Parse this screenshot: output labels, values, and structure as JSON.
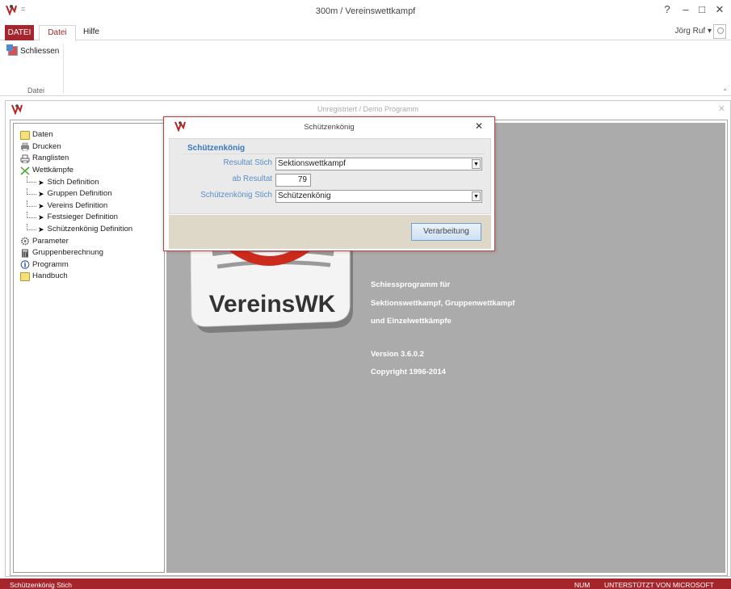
{
  "window": {
    "title": "300m / Vereinswettkampf"
  },
  "title_controls": {
    "help": "?",
    "minimize": "–",
    "maximize": "□",
    "close": "✕"
  },
  "ribbon": {
    "file_tab": "DATEI",
    "tabs": [
      "Datei",
      "Hilfe"
    ],
    "active_tab": "Datei",
    "user": "Jörg Ruf ▾",
    "close_button": "Schliessen",
    "group_label": "Datei"
  },
  "main_window": {
    "title": "Unregistriert  /  Demo Programm"
  },
  "tree": {
    "items": [
      {
        "label": "Daten",
        "icon": "folder-icon",
        "level": 0
      },
      {
        "label": "Drucken",
        "icon": "printer-icon",
        "level": 0
      },
      {
        "label": "Ranglisten",
        "icon": "print-list-icon",
        "level": 0
      },
      {
        "label": "Wettkämpfe",
        "icon": "competition-icon",
        "level": 0
      },
      {
        "label": "Stich Definition",
        "icon": "arrow-icon",
        "level": 1
      },
      {
        "label": "Gruppen Definition",
        "icon": "arrow-icon",
        "level": 1
      },
      {
        "label": "Vereins Definition",
        "icon": "arrow-icon",
        "level": 1
      },
      {
        "label": "Festsieger Definition",
        "icon": "arrow-icon",
        "level": 1
      },
      {
        "label": "Schützenkönig Definition",
        "icon": "arrow-icon",
        "level": 1
      },
      {
        "label": "Parameter",
        "icon": "gear-icon",
        "level": 0
      },
      {
        "label": "Gruppenberechnung",
        "icon": "calculator-icon",
        "level": 0
      },
      {
        "label": "Programm",
        "icon": "info-icon",
        "level": 0
      },
      {
        "label": "Handbuch",
        "icon": "folder-icon",
        "level": 0
      }
    ]
  },
  "splash": {
    "logo_text": "VereinsWK",
    "lines": [
      "Schiessprogramm für",
      "Sektionswettkampf, Gruppenwettkampf",
      "und Einzelwettkämpfe",
      "",
      "Version 3.6.0.2",
      "Copyright  1996-2014"
    ]
  },
  "dialog": {
    "title": "Schützenkönig",
    "close": "✕",
    "section": "Schützenkönig",
    "fields": {
      "resultat_stich": {
        "label": "Resultat Stich",
        "value": "Sektionswettkampf"
      },
      "ab_resultat": {
        "label": "ab Resultat",
        "value": "79"
      },
      "koenig_stich": {
        "label": "Schützenkönig Stich",
        "value": "Schützenkönig"
      }
    },
    "button": "Verarbeitung",
    "dropdown_glyph": "▼"
  },
  "status": {
    "left": "Schützenkönig Stich",
    "num": "NUM",
    "right": "UNTERSTÜTZT VON MICROSOFT ACCESS"
  },
  "colors": {
    "accent": "#a4262c",
    "label_blue": "#5b8fc7",
    "content_gray": "#ababab"
  }
}
